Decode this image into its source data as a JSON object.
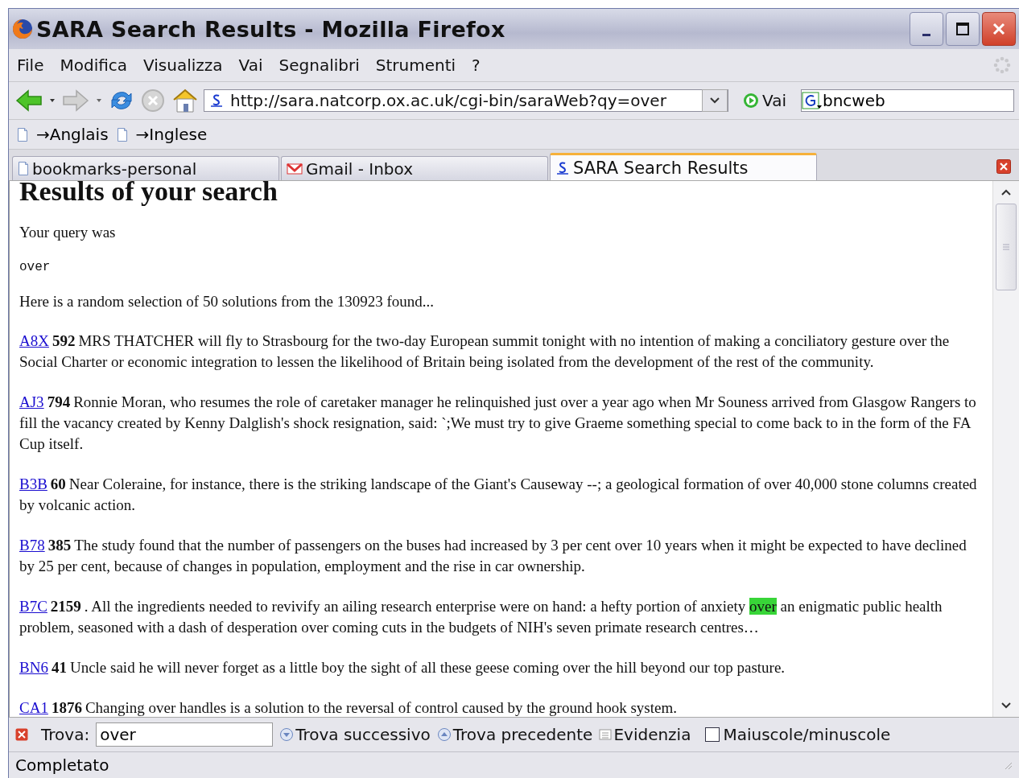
{
  "window": {
    "title": "SARA Search Results - Mozilla Firefox"
  },
  "menu": [
    "File",
    "Modifica",
    "Visualizza",
    "Vai",
    "Segnalibri",
    "Strumenti",
    "?"
  ],
  "address": {
    "value": "http://sara.natcorp.ox.ac.uk/cgi-bin/saraWeb?qy=over",
    "go_label": "Vai",
    "search_value": "bncweb"
  },
  "bookmarks": [
    "→Anglais",
    "→Inglese"
  ],
  "tabs": [
    {
      "label": "bookmarks-personal",
      "selected": false
    },
    {
      "label": "Gmail - Inbox",
      "selected": false
    },
    {
      "label": "SARA Search Results",
      "selected": true
    }
  ],
  "page": {
    "heading": "Results of your search",
    "query_label": "Your query was",
    "query": "over",
    "summary": "Here is a random selection of 50 solutions from the 130923 found...",
    "results": [
      {
        "code": "A8X",
        "number": "592",
        "segments": [
          {
            "text": "MRS THATCHER will fly to Strasbourg for the two-day European summit tonight with no intention of making a conciliatory gesture over the Social Charter or economic integration to lessen the likelihood of Britain being isolated from the development of the rest of the community.",
            "highlighted": false
          }
        ]
      },
      {
        "code": "AJ3",
        "number": "794",
        "segments": [
          {
            "text": "Ronnie Moran, who resumes the role of caretaker manager he relinquished just over a year ago when Mr Souness arrived from Glasgow Rangers to fill the vacancy created by Kenny Dalglish's shock resignation, said: `;We must try to give Graeme something special to come back to in the form of the FA Cup itself.",
            "highlighted": false
          }
        ]
      },
      {
        "code": "B3B",
        "number": "60",
        "segments": [
          {
            "text": "Near Coleraine, for instance, there is the striking landscape of the Giant's Causeway --; a geological formation of over 40,000 stone columns created by volcanic action.",
            "highlighted": false
          }
        ]
      },
      {
        "code": "B78",
        "number": "385",
        "segments": [
          {
            "text": "The study found that the number of passengers on the buses had increased by 3 per cent over 10 years when it might be expected to have declined by 25 per cent, because of changes in population, employment and the rise in car ownership.",
            "highlighted": false
          }
        ]
      },
      {
        "code": "B7C",
        "number": "2159",
        "segments": [
          {
            "text": ". All the ingredients needed to revivify an ailing research enterprise were on hand: a hefty portion of anxiety ",
            "highlighted": false
          },
          {
            "text": "over",
            "highlighted": true
          },
          {
            "text": " an enigmatic public health problem, seasoned with a dash of desperation over coming cuts in the budgets of NIH's seven primate research centres…",
            "highlighted": false
          }
        ]
      },
      {
        "code": "BN6",
        "number": "41",
        "segments": [
          {
            "text": "Uncle said he will never forget as a little boy the sight of all these geese coming over the hill beyond our top pasture.",
            "highlighted": false
          }
        ]
      },
      {
        "code": "CA1",
        "number": "1876",
        "segments": [
          {
            "text": "Changing over handles is a solution to the reversal of control caused by the ground hook system.",
            "highlighted": false
          }
        ]
      }
    ]
  },
  "find_bar": {
    "label": "Trova:",
    "value": "over",
    "next": "Trova successivo",
    "previous": "Trova precedente",
    "highlight": "Evidenzia",
    "match_case": {
      "label": "Maiuscole/minuscole",
      "checked": false
    }
  },
  "status_bar": {
    "text": "Completato"
  }
}
